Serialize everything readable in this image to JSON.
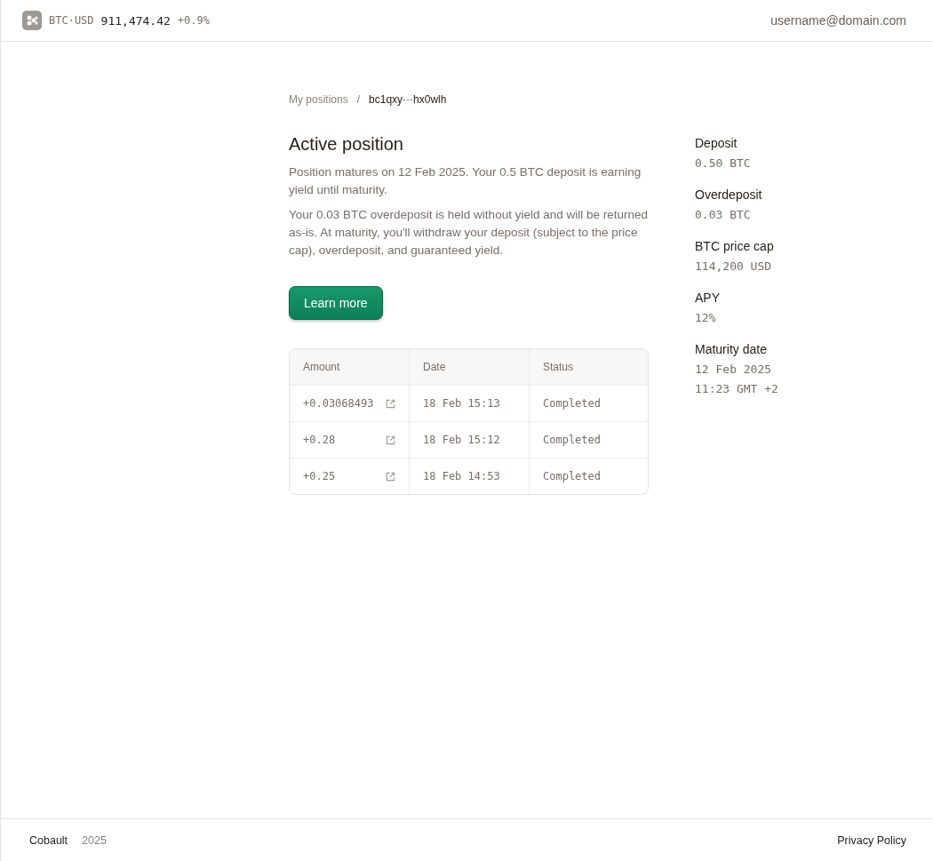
{
  "header": {
    "pair": "BTC·USD",
    "price": "911,474.42",
    "change": "+0.9%",
    "account": "username@domain.com"
  },
  "breadcrumb": {
    "parent": "My positions",
    "separator": "/",
    "current": "bc1qxy···hx0wlh"
  },
  "title": "Active position",
  "paragraphs": [
    "Position matures on 12 Feb 2025. Your 0.5 BTC deposit is earning yield until maturity.",
    "Your 0.03 BTC overdeposit is held without yield and will be returned as-is. At maturity, you'll withdraw your deposit (subject to the price cap), overdeposit, and guaranteed yield."
  ],
  "button": "Learn more",
  "table": {
    "columns": [
      "Amount",
      "Date",
      "Status"
    ],
    "rows": [
      {
        "amount": "+0.03068493",
        "date": "18 Feb 15:13",
        "status": "Completed"
      },
      {
        "amount": "+0.28",
        "date": "18 Feb 15:12",
        "status": "Completed"
      },
      {
        "amount": "+0.25",
        "date": "18 Feb 14:53",
        "status": "Completed"
      }
    ]
  },
  "details": [
    {
      "label": "Deposit",
      "value": "0.50 BTC"
    },
    {
      "label": "Overdeposit",
      "value": "0.03 BTC"
    },
    {
      "label": "BTC price cap",
      "value": "114,200 USD"
    },
    {
      "label": "APY",
      "value": "12%"
    },
    {
      "label": "Maturity date",
      "value": "12 Feb 2025 11:23 GMT +2"
    }
  ],
  "footer": {
    "brand": "Cobault",
    "year": "2025",
    "link": "Privacy Policy"
  }
}
